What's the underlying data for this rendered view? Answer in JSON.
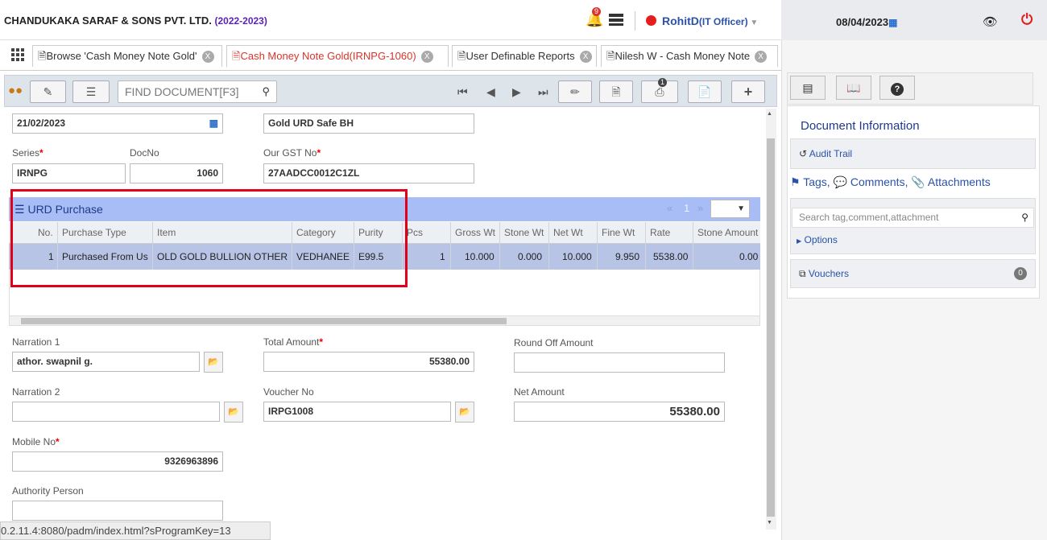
{
  "header": {
    "company": "CHANDUKAKA SARAF & SONS PVT. LTD.",
    "year": "(2022-2023)",
    "notif_count": "9",
    "user": "RohitD",
    "role": "(IT Officer)",
    "date": "08/04/2023"
  },
  "tabs": [
    {
      "label": "Browse 'Cash Money Note Gold'"
    },
    {
      "label": "Cash Money Note Gold(IRNPG-1060)"
    },
    {
      "label": "User Definable Reports"
    },
    {
      "label": "Nilesh W - Cash Money Note"
    }
  ],
  "toolbar": {
    "find_placeholder": "FIND DOCUMENT[F3]",
    "print_badge": "1"
  },
  "form": {
    "date": "21/02/2023",
    "safe": "Gold URD Safe BH",
    "series_label": "Series",
    "series": "IRNPG",
    "docno_label": "DocNo",
    "docno": "1060",
    "gst_label": "Our GST No",
    "gst": "27AADCC0012C1ZL",
    "narration1_label": "Narration 1",
    "narration1": "athor. swapnil g.",
    "total_label": "Total Amount",
    "total": "55380.00",
    "roundoff_label": "Round Off Amount",
    "roundoff": "",
    "narration2_label": "Narration 2",
    "narration2": "",
    "voucher_label": "Voucher No",
    "voucher": "IRPG1008",
    "net_label": "Net Amount",
    "net": "55380.00",
    "mobile_label": "Mobile No",
    "mobile": "9326963896",
    "authority_label": "Authority Person",
    "authority": ""
  },
  "grid": {
    "title": "URD Purchase",
    "page": "1",
    "columns": [
      "No.",
      "Purchase Type",
      "Item",
      "Category",
      "Purity",
      "Pcs",
      "Gross Wt",
      "Stone Wt",
      "Net Wt",
      "Fine Wt",
      "Rate",
      "Stone Amount"
    ],
    "row": [
      "1",
      "Purchased From Us",
      "OLD GOLD BULLION OTHER",
      "VEDHANEE",
      "E99.5",
      "1",
      "10.000",
      "0.000",
      "10.000",
      "9.950",
      "5538.00",
      "0.00"
    ]
  },
  "right_panel": {
    "title": "Document Information",
    "audit": "Audit Trail",
    "tags": "Tags,",
    "comments": "Comments,",
    "attachments": "Attachments",
    "search_placeholder": "Search tag,comment,attachment",
    "options": "Options",
    "vouchers": "Vouchers",
    "vouchers_count": "0"
  },
  "status_url": "0.2.11.4:8080/padm/index.html?sProgramKey=13"
}
